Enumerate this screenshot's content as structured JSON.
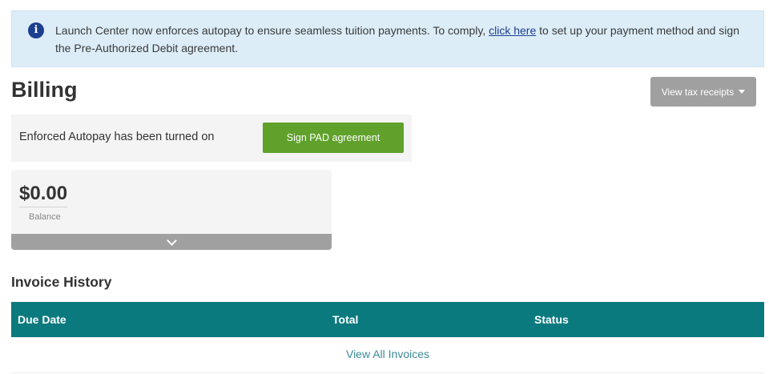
{
  "alert": {
    "icon": "info-icon",
    "icon_glyph": "i",
    "text_before": "Launch Center now enforces autopay to ensure seamless tuition payments. To comply, ",
    "link_text": "click here",
    "text_after": " to set up your payment method and sign the Pre-Authorized Debit agreement."
  },
  "page": {
    "title": "Billing"
  },
  "tax_receipts": {
    "label": "View tax receipts",
    "icon": "caret-down-icon"
  },
  "autopay": {
    "status_text": "Enforced Autopay has been turned on",
    "button_label": "Sign PAD agreement",
    "button_color": "#5fa12b"
  },
  "balance": {
    "amount": "$0.00",
    "label": "Balance",
    "expand_icon": "chevron-down-icon"
  },
  "invoices": {
    "title": "Invoice History",
    "columns": [
      "Due Date",
      "Total",
      "Status"
    ],
    "rows": [],
    "view_all_label": "View All Invoices",
    "header_color": "#0a7a7e"
  }
}
